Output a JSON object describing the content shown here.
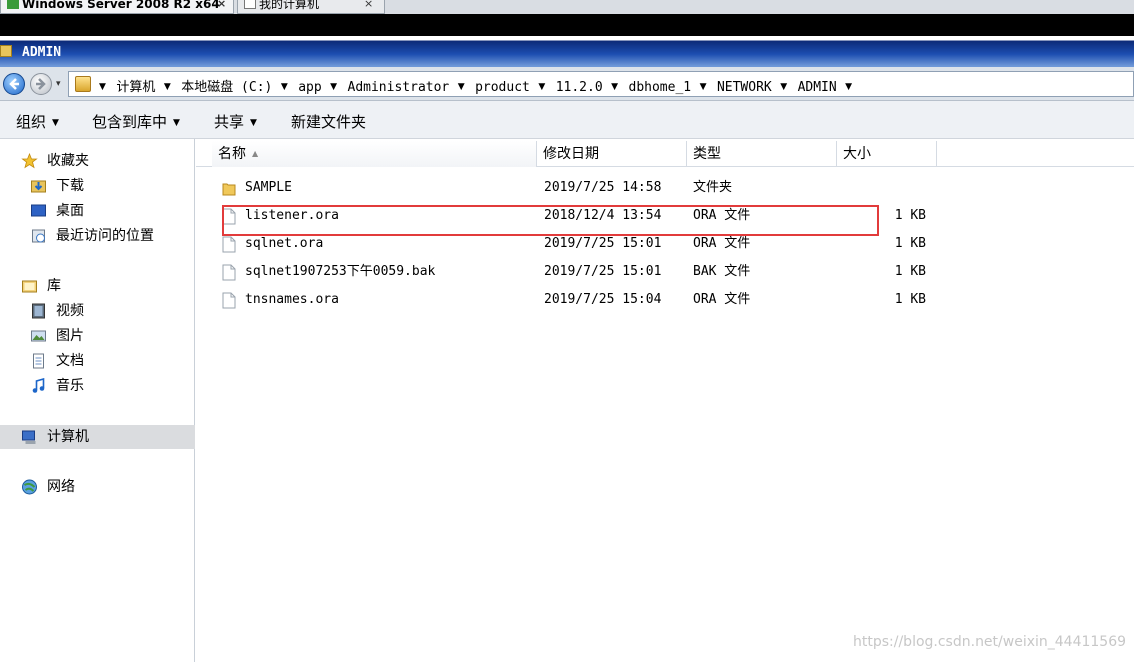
{
  "vm_tabs": [
    {
      "label": "Windows Server 2008 R2 x64",
      "close": "×"
    },
    {
      "label": "我的计算机",
      "close": "×"
    }
  ],
  "window": {
    "title": "ADMIN"
  },
  "address": {
    "dropdown_glyph": "▾",
    "crumbs": [
      "计算机",
      "本地磁盘 (C:)",
      "app",
      "Administrator",
      "product",
      "11.2.0",
      "dbhome_1",
      "NETWORK",
      "ADMIN"
    ],
    "arrow": "▼"
  },
  "toolbar": {
    "organize": "组织",
    "include": "包含到库中",
    "share": "共享",
    "new_folder": "新建文件夹",
    "dropdown_glyph": "▼"
  },
  "nav": {
    "favorites": "收藏夹",
    "downloads": "下载",
    "desktop": "桌面",
    "recent": "最近访问的位置",
    "libraries": "库",
    "videos": "视频",
    "pictures": "图片",
    "documents": "文档",
    "music": "音乐",
    "computer": "计算机",
    "network": "网络"
  },
  "columns": {
    "name": "名称",
    "date": "修改日期",
    "type": "类型",
    "size": "大小",
    "sort_glyph": "▲"
  },
  "files": [
    {
      "name": "SAMPLE",
      "date": "2019/7/25 14:58",
      "type": "文件夹",
      "size": "",
      "kind": "folder"
    },
    {
      "name": "listener.ora",
      "date": "2018/12/4 13:54",
      "type": "ORA 文件",
      "size": "1 KB",
      "kind": "file"
    },
    {
      "name": "sqlnet.ora",
      "date": "2019/7/25 15:01",
      "type": "ORA 文件",
      "size": "1 KB",
      "kind": "file"
    },
    {
      "name": "sqlnet1907253下午0059.bak",
      "date": "2019/7/25 15:01",
      "type": "BAK 文件",
      "size": "1 KB",
      "kind": "file"
    },
    {
      "name": "tnsnames.ora",
      "date": "2019/7/25 15:04",
      "type": "ORA 文件",
      "size": "1 KB",
      "kind": "file"
    }
  ],
  "highlighted_file": "listener.ora",
  "watermark": "https://blog.csdn.net/weixin_44411569",
  "colors": {
    "highlight": "#e23b3b",
    "title_bar": "#1c4db0",
    "selected_nav": "#dadcdf"
  }
}
